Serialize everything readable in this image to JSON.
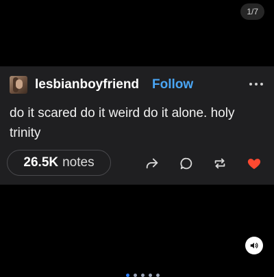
{
  "carousel": {
    "counter": "1/7",
    "dots": 5,
    "active_dot": 0
  },
  "post": {
    "username": "lesbianboyfriend",
    "follow_label": "Follow",
    "text": "do it scared do it weird do it alone. holy trinity",
    "notes_count": "26.5K",
    "notes_label": "notes"
  },
  "icons": {
    "avatar": "avatar",
    "more": "more-horizontal-icon",
    "share": "share-arrow-icon",
    "reply": "reply-bubble-icon",
    "reblog": "reblog-icon",
    "like": "heart-icon",
    "audio": "speaker-icon"
  },
  "colors": {
    "background": "#000000",
    "card": "#1f1f21",
    "follow": "#4aa6f5",
    "like": "#ff4930",
    "active_dot": "#2c7dfa",
    "dot": "#9ca5b8"
  }
}
